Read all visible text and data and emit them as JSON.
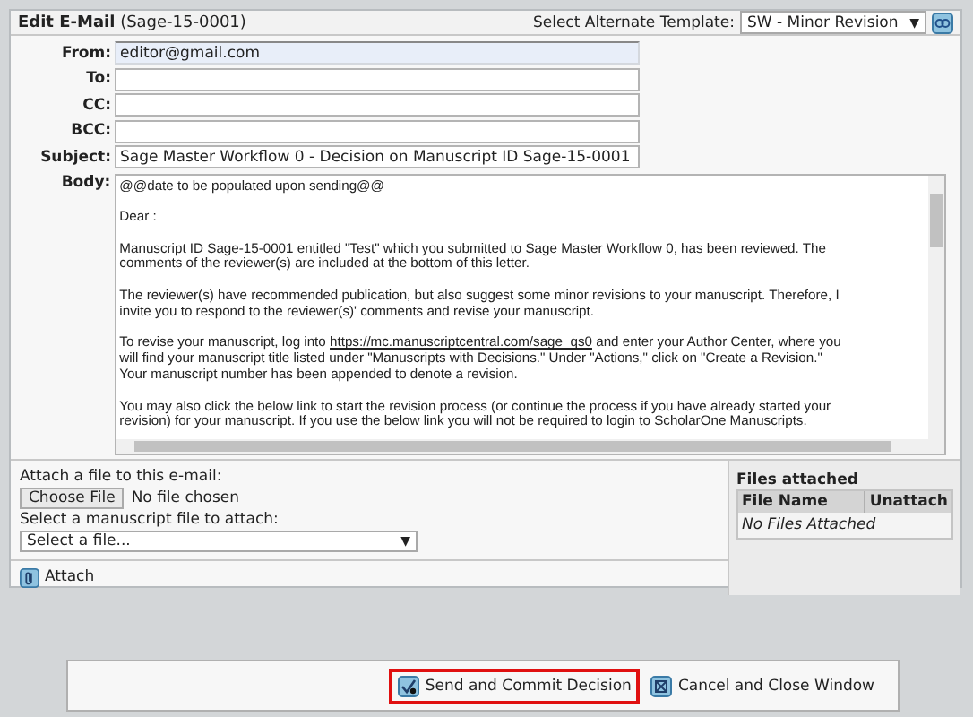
{
  "window": {
    "title": "Edit E-Mail",
    "id": "(Sage-15-0001)"
  },
  "template": {
    "label": "Select Alternate Template:",
    "value": "SW - Minor Revision",
    "arrow": "▼"
  },
  "fields": [
    {
      "label": "From:",
      "value": "editor@gmail.com",
      "readonly": true
    },
    {
      "label": "To:",
      "readonly": false
    },
    {
      "label": "CC:",
      "readonly": false
    },
    {
      "label": "BCC:",
      "readonly": false
    },
    {
      "label": "Subject:",
      "value": "Sage Master Workflow 0 - Decision on Manuscript ID Sage-15-0001",
      "readonly": false
    }
  ],
  "body": {
    "label": "Body:",
    "paragraphs": [
      [
        "@@date to be populated upon sending@@"
      ],
      [
        "Dear :"
      ],
      [
        "Manuscript ID Sage-15-0001 entitled \"Test\" which you submitted to Sage Master Workflow 0, has been reviewed.  The",
        "comments of the reviewer(s) are included at the bottom of this letter."
      ],
      [
        "The reviewer(s) have recommended publication, but also suggest some minor revisions to your manuscript.  Therefore, I",
        "invite you to respond to the reviewer(s)' comments and revise your manuscript."
      ],
      [
        {
          "before": "To revise your manuscript, log into",
          "link": "https://mc.manuscriptcentral.com/sage_qs0",
          "after": "and enter your Author Center, where you"
        },
        "will find your manuscript title listed under \"Manuscripts with Decisions.\"  Under \"Actions,\" click on \"Create a Revision.\"",
        "Your manuscript number has been appended to denote a revision."
      ],
      [
        "You may also click the below link to start the revision process (or continue the process if you have already started your",
        "revision) for your manuscript. If you use the below link you will not be required to login to ScholarOne Manuscripts."
      ]
    ]
  },
  "attach": {
    "label": "Attach a file to this e-mail:",
    "choose": "Choose File",
    "no_file": "No file chosen",
    "select_label": "Select a manuscript file to attach:",
    "select_value": "Select a file...",
    "arrow": "▼",
    "button": "Attach"
  },
  "files_attached": {
    "title": "Files attached",
    "columns": [
      "File Name",
      "Unattach"
    ],
    "empty": "No Files Attached"
  },
  "buttons": [
    {
      "label": "Send and Commit Decision",
      "kind": "send",
      "highlighted": true
    },
    {
      "label": "Cancel and Close Window",
      "kind": "cancel",
      "highlighted": false
    }
  ]
}
